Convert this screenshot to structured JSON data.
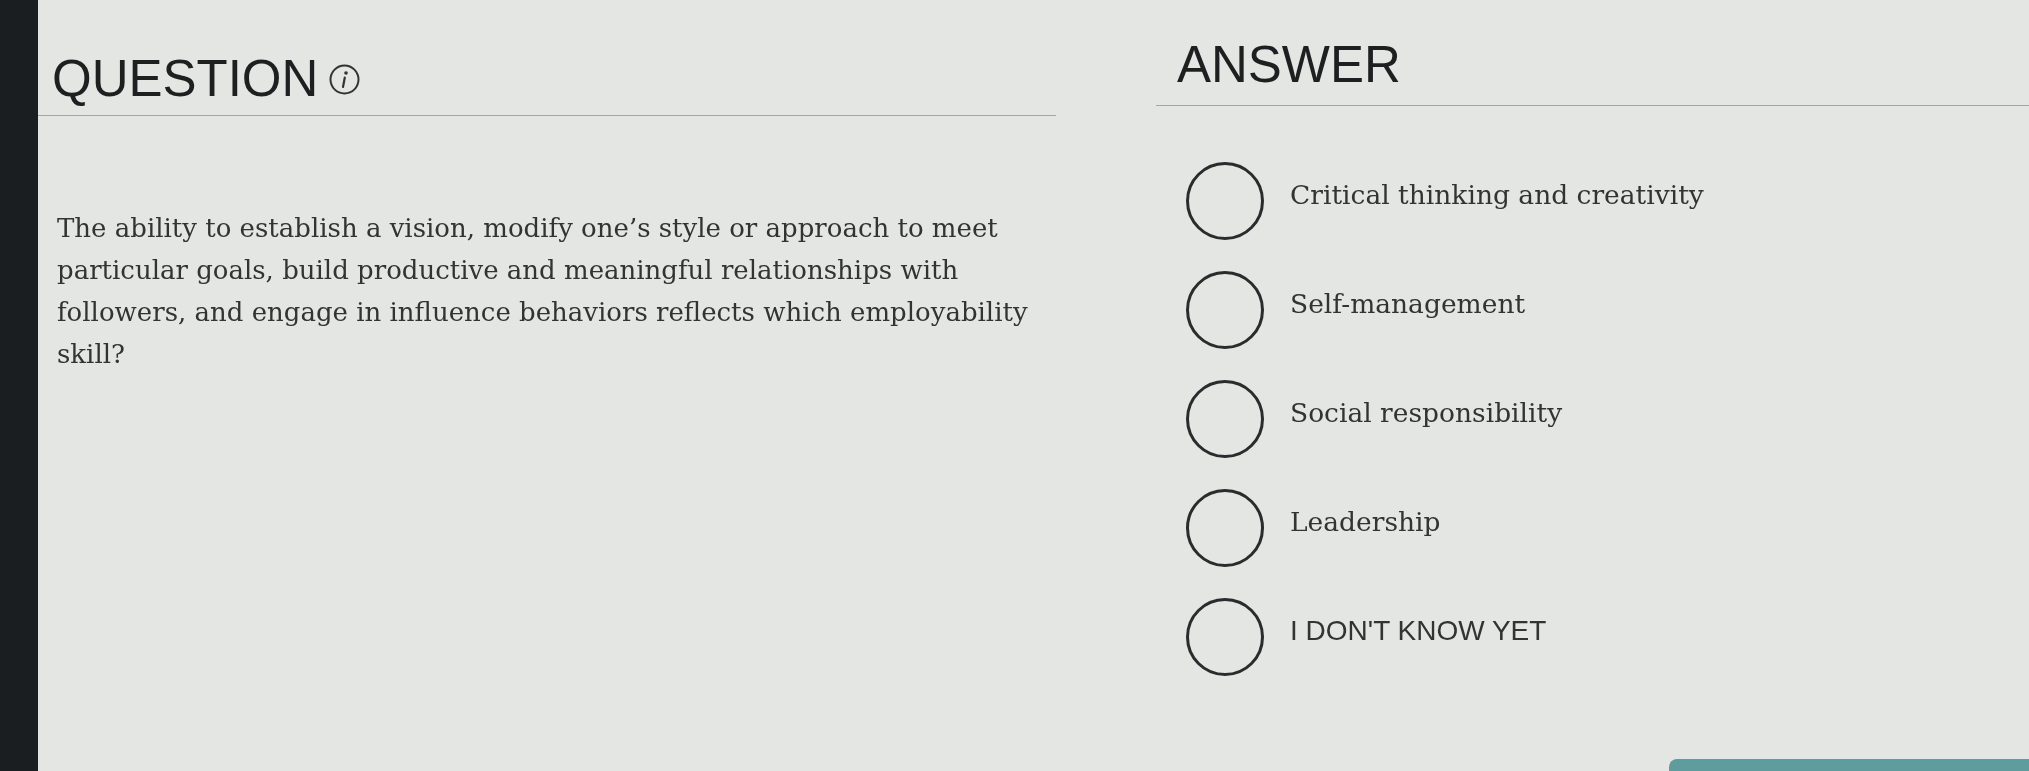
{
  "question": {
    "heading": "QUESTION",
    "text": "The ability to establish a vision, modify one’s style or approach to meet particular goals, build productive and meaningful relationships with followers, and engage in influence behaviors reflects which employability skill?"
  },
  "answer": {
    "heading": "ANSWER",
    "options": [
      {
        "kind": "choice",
        "label": "Critical thinking and creativity",
        "selected": false
      },
      {
        "kind": "choice",
        "label": "Self-management",
        "selected": false
      },
      {
        "kind": "choice",
        "label": "Social responsibility",
        "selected": false
      },
      {
        "kind": "choice",
        "label": "Leadership",
        "selected": false
      },
      {
        "kind": "dont_know",
        "label": "I DON'T KNOW YET",
        "selected": false
      }
    ]
  },
  "footer_button": {
    "visible": true
  }
}
